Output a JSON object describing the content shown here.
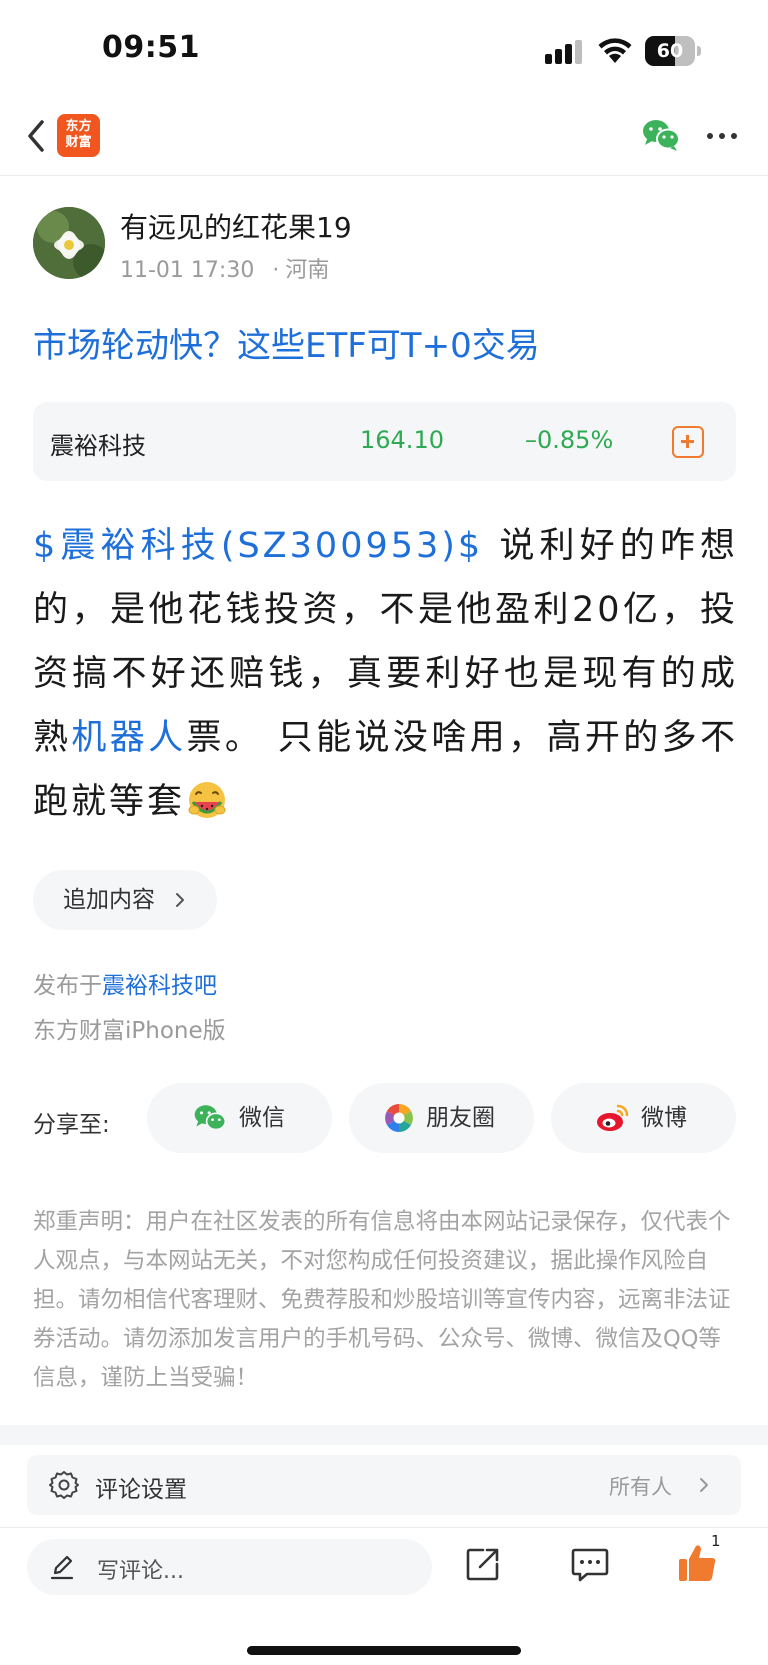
{
  "status_bar": {
    "time": "09:51",
    "battery": "60",
    "battery_level_percent": 60
  },
  "nav": {
    "logo_line1": "东方",
    "logo_line2": "财富",
    "logo_color": "#f0561e"
  },
  "post": {
    "author": "有远见的红花果19",
    "datetime": "11-01 17:30",
    "location": "河南",
    "title": "市场轮动快？这些ETF可T+0交易",
    "stock": {
      "name": "震裕科技",
      "price": "164.10",
      "change": "–0.85%"
    },
    "body": {
      "stock_link": "$震裕科技(SZ300953)$",
      "text1": " 说利好的咋想的，是他花钱投资，不是他盈利20亿，投资搞不好还赔钱，真要利好也是现有的成熟",
      "topic_link": "机器人",
      "text2": "票。 只能说没啥用，高开的多不跑就等套"
    },
    "add_content": "追加内容",
    "published_prefix": "发布于",
    "published_bar": "震裕科技吧",
    "client": "东方财富iPhone版"
  },
  "share": {
    "label": "分享至:",
    "wechat": "微信",
    "moments": "朋友圈",
    "weibo": "微博"
  },
  "disclaimer": "郑重声明：用户在社区发表的所有信息将由本网站记录保存，仅代表个人观点，与本网站无关，不对您构成任何投资建议，据此操作风险自担。请勿相信代客理财、免费荐股和炒股培训等宣传内容，远离非法证券活动。请勿添加发言用户的手机号码、公众号、微博、微信及QQ等信息，谨防上当受骗！",
  "comment_settings": {
    "label": "评论设置",
    "scope": "所有人"
  },
  "bottom_bar": {
    "placeholder": "写评论...",
    "like_count": "1"
  },
  "colors": {
    "link": "#1e6fd9",
    "down": "#2eaa52",
    "accent": "#f07a2e"
  }
}
